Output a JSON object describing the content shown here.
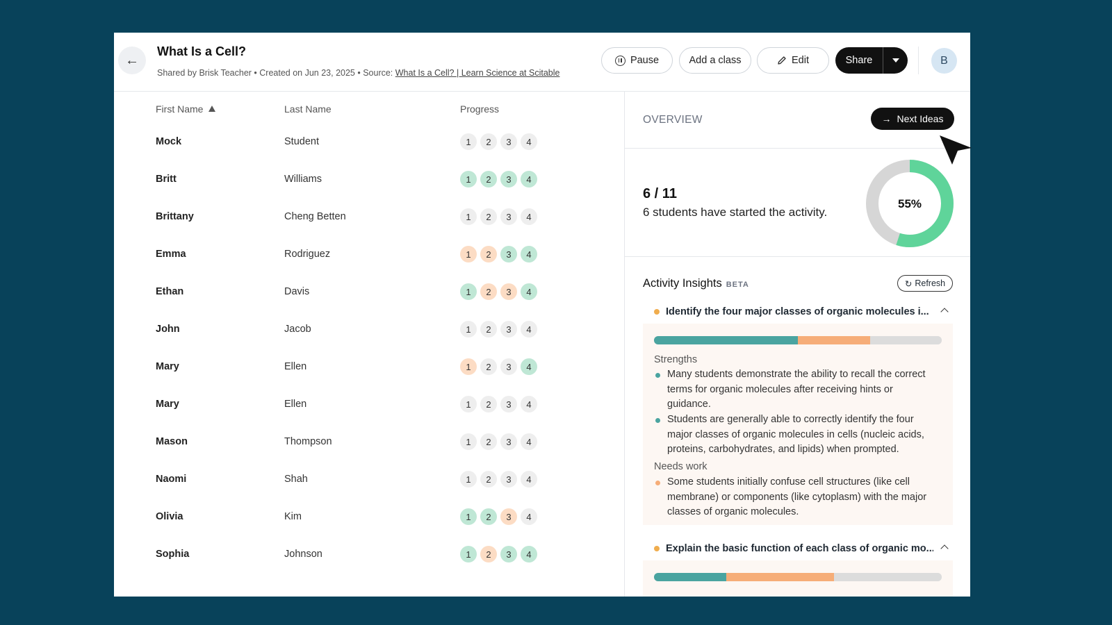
{
  "header": {
    "title": "What Is a Cell?",
    "subtitle_prefix": "Shared by Brisk Teacher • Created on Jun 23, 2025 • Source: ",
    "source_link": "What Is a Cell? | Learn Science at Scitable",
    "pause_label": "Pause",
    "add_class_label": "Add a class",
    "edit_label": "Edit",
    "share_label": "Share",
    "avatar_initial": "B"
  },
  "table": {
    "col_first": "First Name",
    "col_last": "Last Name",
    "col_progress": "Progress",
    "rows": [
      {
        "first": "Mock",
        "last": "Student",
        "steps": [
          {
            "n": "1",
            "s": "none"
          },
          {
            "n": "2",
            "s": "none"
          },
          {
            "n": "3",
            "s": "none"
          },
          {
            "n": "4",
            "s": "none"
          }
        ]
      },
      {
        "first": "Britt",
        "last": "Williams",
        "steps": [
          {
            "n": "1",
            "s": "done"
          },
          {
            "n": "2",
            "s": "done"
          },
          {
            "n": "3",
            "s": "done"
          },
          {
            "n": "4",
            "s": "done"
          }
        ]
      },
      {
        "first": "Brittany",
        "last": "Cheng Betten",
        "steps": [
          {
            "n": "1",
            "s": "none"
          },
          {
            "n": "2",
            "s": "none"
          },
          {
            "n": "3",
            "s": "none"
          },
          {
            "n": "4",
            "s": "none"
          }
        ]
      },
      {
        "first": "Emma",
        "last": "Rodriguez",
        "steps": [
          {
            "n": "1",
            "s": "warn"
          },
          {
            "n": "2",
            "s": "warn"
          },
          {
            "n": "3",
            "s": "done"
          },
          {
            "n": "4",
            "s": "done"
          }
        ]
      },
      {
        "first": "Ethan",
        "last": "Davis",
        "steps": [
          {
            "n": "1",
            "s": "done"
          },
          {
            "n": "2",
            "s": "warn"
          },
          {
            "n": "3",
            "s": "warn"
          },
          {
            "n": "4",
            "s": "done"
          }
        ]
      },
      {
        "first": "John",
        "last": "Jacob",
        "steps": [
          {
            "n": "1",
            "s": "none"
          },
          {
            "n": "2",
            "s": "none"
          },
          {
            "n": "3",
            "s": "none"
          },
          {
            "n": "4",
            "s": "none"
          }
        ]
      },
      {
        "first": "Mary",
        "last": "Ellen",
        "steps": [
          {
            "n": "1",
            "s": "warn"
          },
          {
            "n": "2",
            "s": "none"
          },
          {
            "n": "3",
            "s": "none"
          },
          {
            "n": "4",
            "s": "done"
          }
        ]
      },
      {
        "first": "Mary",
        "last": "Ellen",
        "steps": [
          {
            "n": "1",
            "s": "none"
          },
          {
            "n": "2",
            "s": "none"
          },
          {
            "n": "3",
            "s": "none"
          },
          {
            "n": "4",
            "s": "none"
          }
        ]
      },
      {
        "first": "Mason",
        "last": "Thompson",
        "steps": [
          {
            "n": "1",
            "s": "none"
          },
          {
            "n": "2",
            "s": "none"
          },
          {
            "n": "3",
            "s": "none"
          },
          {
            "n": "4",
            "s": "none"
          }
        ]
      },
      {
        "first": "Naomi",
        "last": "Shah",
        "steps": [
          {
            "n": "1",
            "s": "none"
          },
          {
            "n": "2",
            "s": "none"
          },
          {
            "n": "3",
            "s": "none"
          },
          {
            "n": "4",
            "s": "none"
          }
        ]
      },
      {
        "first": "Olivia",
        "last": "Kim",
        "steps": [
          {
            "n": "1",
            "s": "done"
          },
          {
            "n": "2",
            "s": "done"
          },
          {
            "n": "3",
            "s": "warn"
          },
          {
            "n": "4",
            "s": "none"
          }
        ]
      },
      {
        "first": "Sophia",
        "last": "Johnson",
        "steps": [
          {
            "n": "1",
            "s": "done"
          },
          {
            "n": "2",
            "s": "warn"
          },
          {
            "n": "3",
            "s": "done"
          },
          {
            "n": "4",
            "s": "done"
          }
        ]
      }
    ]
  },
  "overview": {
    "label": "OVERVIEW",
    "next_ideas_label": "Next Ideas",
    "count": "6 / 11",
    "count_text": "6 students have started the activity.",
    "percent_label": "55%",
    "percent_value": 55,
    "ring_color": "#5fd49a",
    "ring_track_color": "#d6d6d6"
  },
  "insights": {
    "title": "Activity Insights",
    "beta": "BETA",
    "refresh_label": "Refresh",
    "objectives": [
      {
        "heading": "Identify the four major classes of organic molecules i...",
        "bar": {
          "teal": 50,
          "orange": 25
        },
        "strengths_label": "Strengths",
        "strengths": [
          "Many students demonstrate the ability to recall the correct terms for organic molecules after receiving hints or guidance.",
          "Students are generally able to correctly identify the four major classes of organic molecules in cells (nucleic acids, proteins, carbohydrates, and lipids) when prompted."
        ],
        "needs_label": "Needs work",
        "needs": [
          "Some students initially confuse cell structures (like cell membrane) or components (like cytoplasm) with the major classes of organic molecules."
        ]
      },
      {
        "heading": "Explain the basic function of each class of organic mo...",
        "bar": {
          "teal": 25,
          "orange": 37.5
        }
      }
    ]
  }
}
